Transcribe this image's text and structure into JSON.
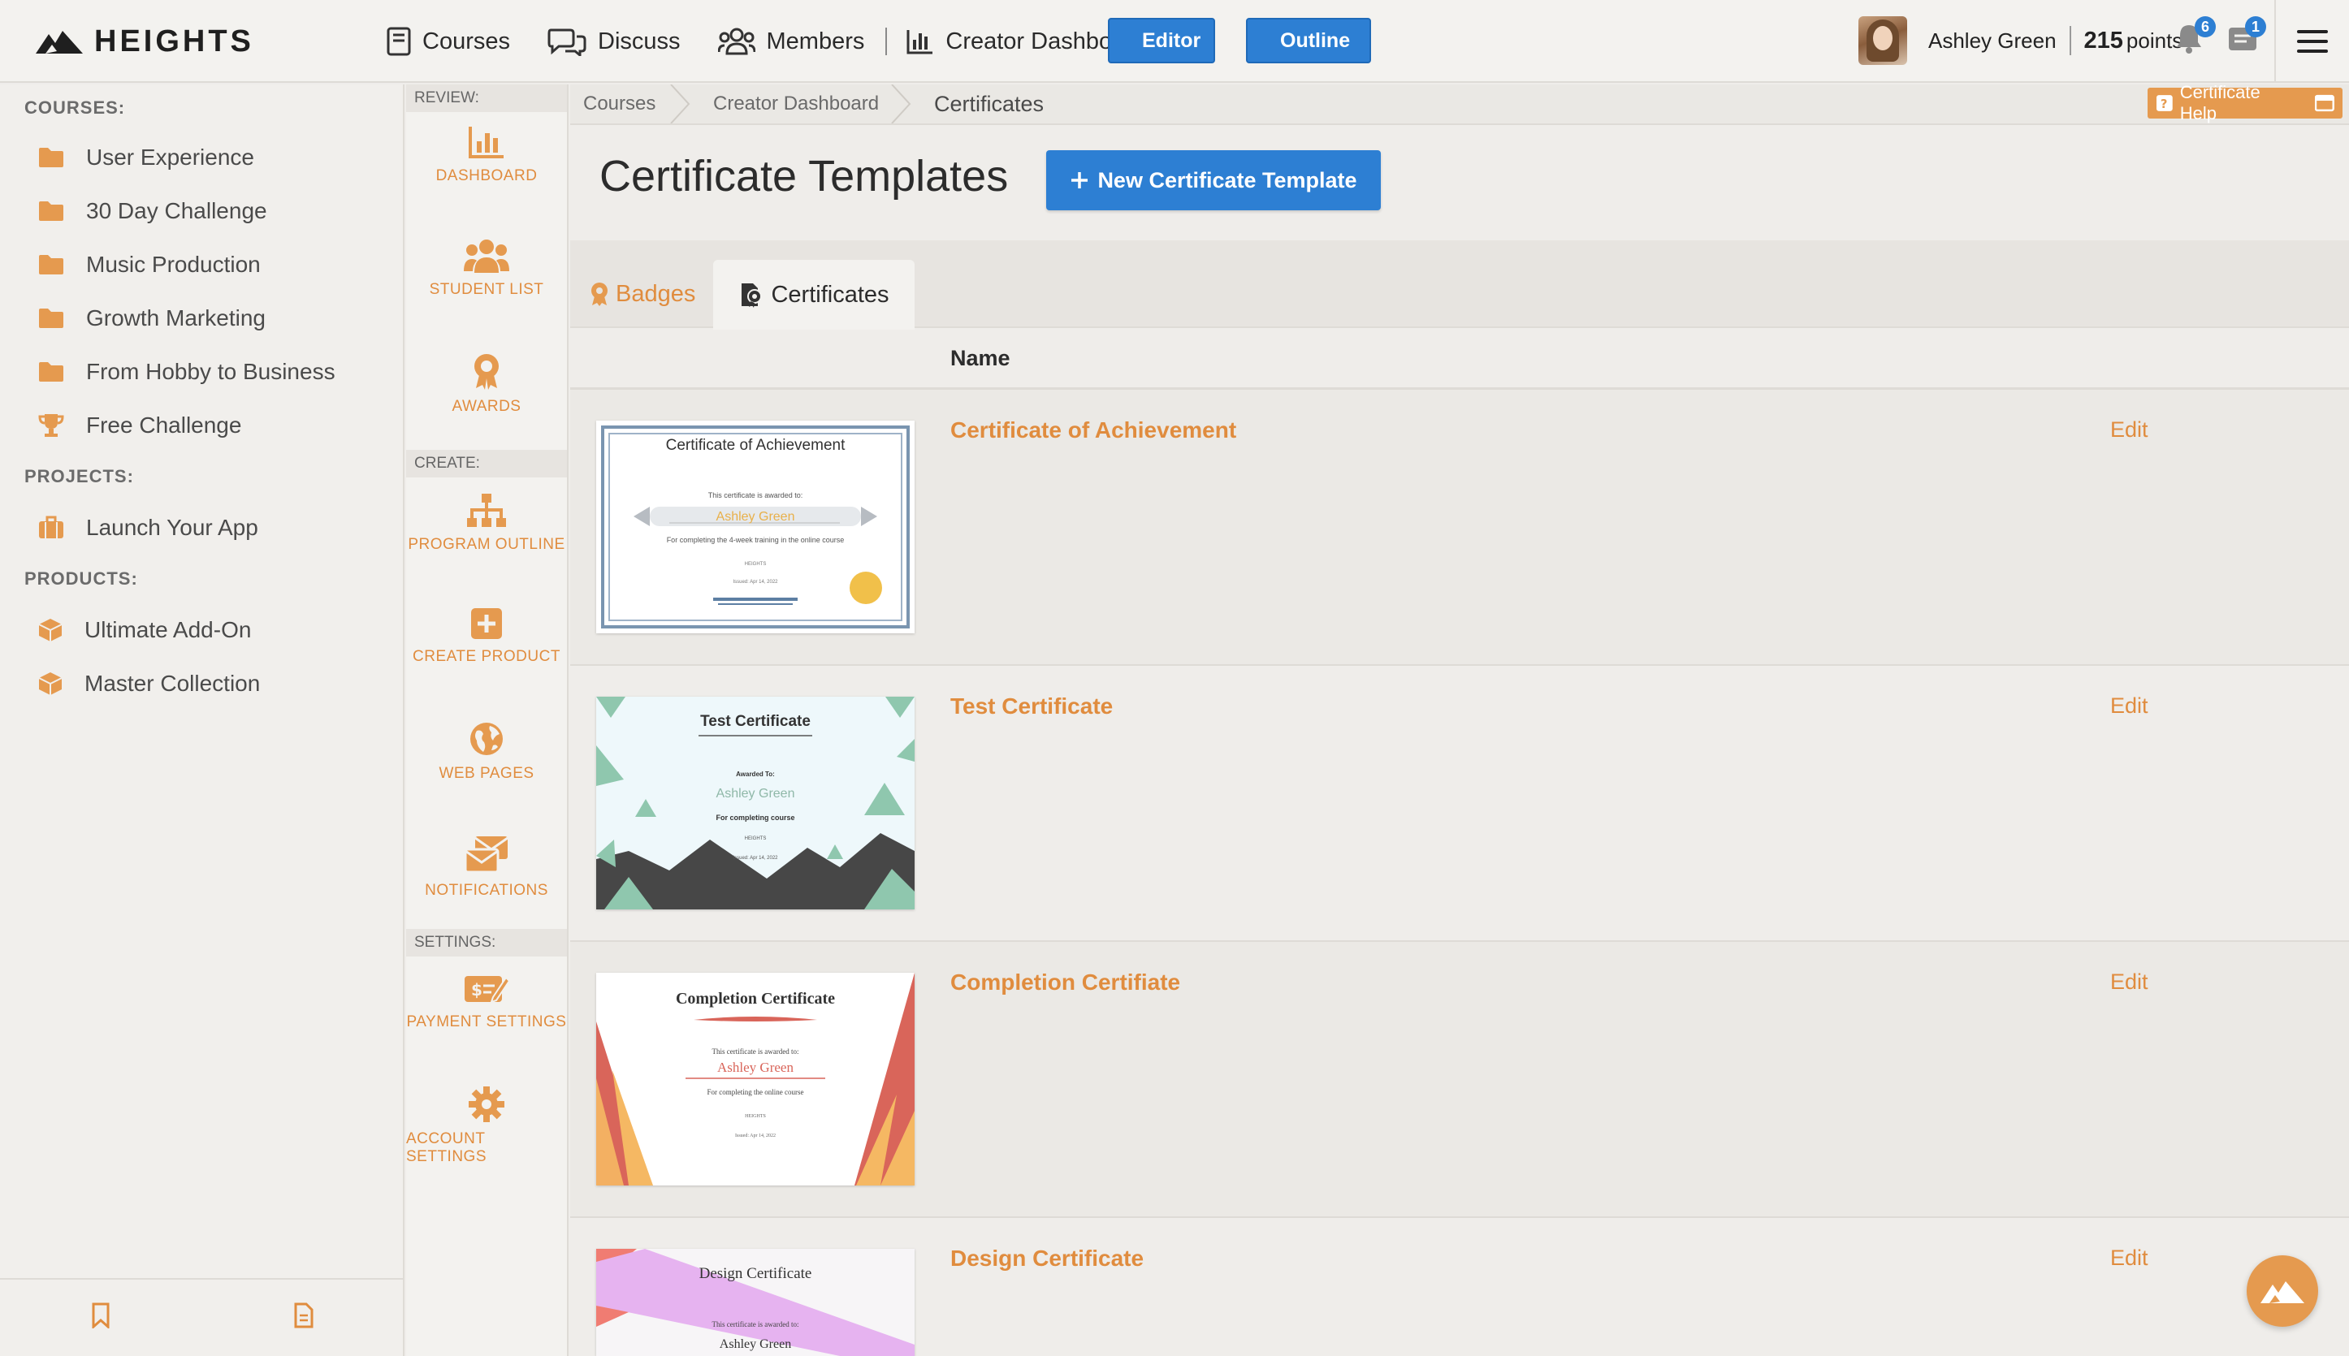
{
  "app": {
    "logo_text": "HEIGHTS"
  },
  "nav": {
    "courses": "Courses",
    "discuss": "Discuss",
    "members": "Members",
    "creator_dashboard": "Creator Dashboard",
    "editor": "Editor",
    "outline": "Outline"
  },
  "user": {
    "name": "Ashley Green",
    "points_value": "215",
    "points_label": "points",
    "notifications_count": "6",
    "messages_count": "1"
  },
  "sidebar": {
    "courses_heading": "COURSES:",
    "courses": [
      {
        "label": "User Experience"
      },
      {
        "label": "30 Day Challenge"
      },
      {
        "label": "Music Production"
      },
      {
        "label": "Growth Marketing"
      },
      {
        "label": "From Hobby to Business"
      },
      {
        "label": "Free Challenge"
      }
    ],
    "projects_heading": "PROJECTS:",
    "projects": [
      {
        "label": "Launch Your App"
      }
    ],
    "products_heading": "PRODUCTS:",
    "products": [
      {
        "label": "Ultimate Add-On"
      },
      {
        "label": "Master Collection"
      }
    ]
  },
  "rail": {
    "review_heading": "REVIEW:",
    "dashboard": "DASHBOARD",
    "student_list": "STUDENT LIST",
    "awards": "AWARDS",
    "create_heading": "CREATE:",
    "program_outline": "PROGRAM OUTLINE",
    "create_product": "CREATE PRODUCT",
    "web_pages": "WEB PAGES",
    "notifications": "NOTIFICATIONS",
    "settings_heading": "SETTINGS:",
    "payment_settings": "PAYMENT SETTINGS",
    "account_settings": "ACCOUNT SETTINGS"
  },
  "breadcrumb": {
    "items": [
      "Courses",
      "Creator Dashboard",
      "Certificates"
    ],
    "help_label": "Certificate Help"
  },
  "main": {
    "title": "Certificate Templates",
    "new_button": "New Certificate Template",
    "tabs": {
      "badges": "Badges",
      "certificates": "Certificates"
    },
    "column_name": "Name",
    "edit_label": "Edit",
    "rows": [
      {
        "name": "Certificate of Achievement",
        "thumb": {
          "heading": "Certificate of Achievement",
          "awarded_line": "This certificate is awarded to:",
          "recipient": "Ashley Green",
          "body": "For completing the 4-week training in the online course",
          "org": "HEIGHTS",
          "issued": "Issued: Apr 14, 2022"
        }
      },
      {
        "name": "Test Certificate",
        "thumb": {
          "heading": "Test Certificate",
          "awarded_line": "Awarded To:",
          "recipient": "Ashley Green",
          "body": "For completing course",
          "org": "HEIGHTS",
          "issued": "Issued: Apr 14, 2022"
        }
      },
      {
        "name": "Completion Certifiate",
        "thumb": {
          "heading": "Completion Certificate",
          "awarded_line": "This certificate is awarded to:",
          "recipient": "Ashley Green",
          "body": "For completing the online course",
          "org": "HEIGHTS",
          "issued": "Issued: Apr 14, 2022"
        }
      },
      {
        "name": "Design Certificate",
        "thumb": {
          "heading": "Design Certificate",
          "awarded_line": "This certificate is awarded to:",
          "recipient": "Ashley Green"
        }
      }
    ]
  },
  "colors": {
    "accent_orange": "#e08c3e",
    "primary_blue": "#2d7fd3"
  }
}
